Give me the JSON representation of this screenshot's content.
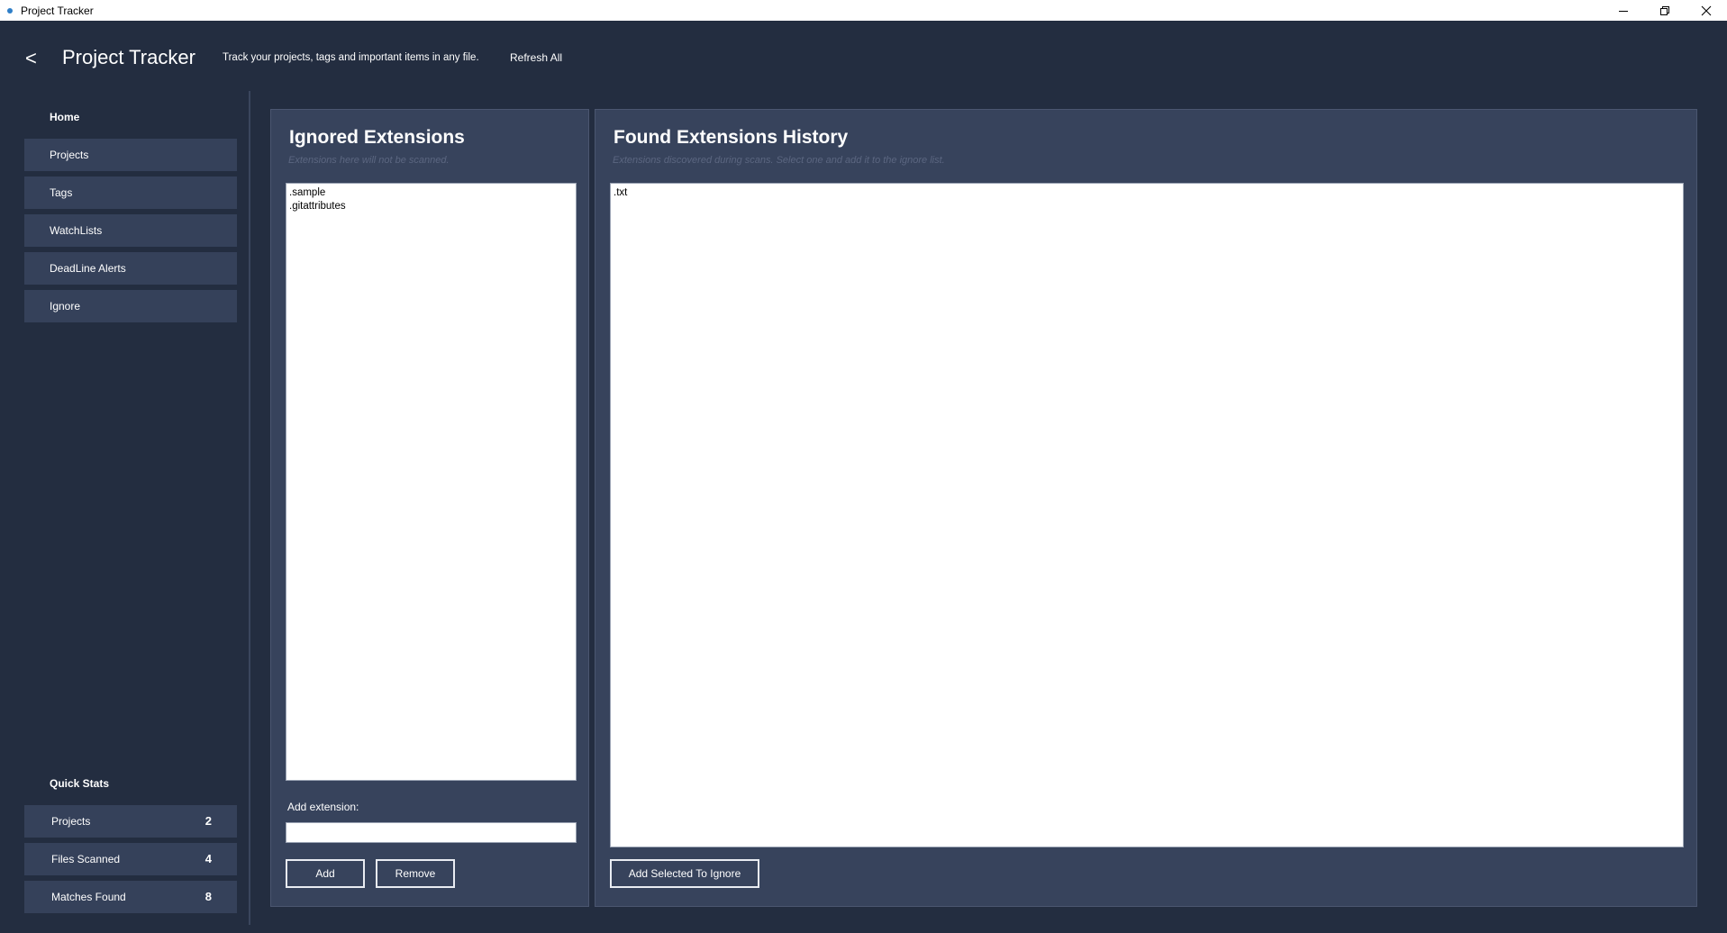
{
  "window": {
    "title": "Project Tracker",
    "controls": [
      "minimize-icon",
      "restore-icon",
      "close-icon"
    ]
  },
  "header": {
    "back_label": "<",
    "app_title": "Project Tracker",
    "tagline": "Track your projects, tags and important items in any file.",
    "refresh_label": "Refresh All"
  },
  "sidebar": {
    "home_label": "Home",
    "items": [
      {
        "label": "Projects"
      },
      {
        "label": "Tags"
      },
      {
        "label": "WatchLists"
      },
      {
        "label": "DeadLine Alerts"
      },
      {
        "label": "Ignore"
      }
    ],
    "quick_stats": {
      "title": "Quick Stats",
      "items": [
        {
          "label": "Projects",
          "value": "2"
        },
        {
          "label": "Files Scanned",
          "value": "4"
        },
        {
          "label": "Matches Found",
          "value": "8"
        }
      ]
    }
  },
  "ignored_panel": {
    "title": "Ignored Extensions",
    "subtitle": "Extensions here will not be scanned.",
    "items": [
      ".sample",
      ".gitattributes"
    ],
    "add_label": "Add extension:",
    "add_input_value": "",
    "add_button": "Add",
    "remove_button": "Remove"
  },
  "found_panel": {
    "title": "Found Extensions History",
    "subtitle": "Extensions discovered during scans. Select one and add it to the ignore list.",
    "items": [
      ".txt"
    ],
    "add_selected_button": "Add Selected To Ignore"
  },
  "colors": {
    "background": "#232d40",
    "panel": "#37435c",
    "nav_item": "#35415a"
  }
}
